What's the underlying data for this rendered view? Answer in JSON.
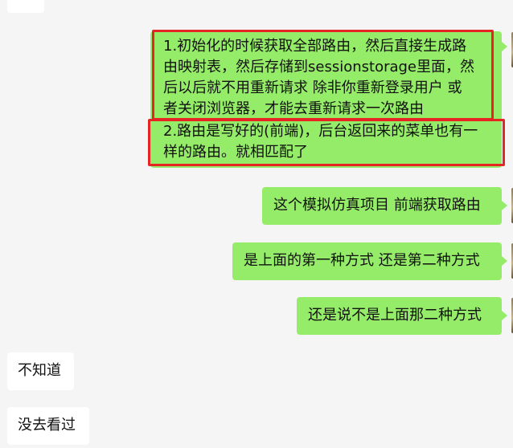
{
  "chat": {
    "messages": [
      {
        "side": "out",
        "lines": [
          "1.初始化的时候获取全部路由，然后直接生成路",
          "由映射表，然后存储到sessionstorage里面，然",
          "后以后就不用重新请求  除非你重新登录用户 或",
          "者关闭浏览器，才能去重新请求一次路由",
          "2.路由是写好的(前端)，后台返回来的菜单也有一",
          "样的路由。就相匹配了"
        ]
      },
      {
        "side": "out",
        "text": "这个模拟仿真项目 前端获取路由"
      },
      {
        "side": "out",
        "text": "是上面的第一种方式 还是第二种方式"
      },
      {
        "side": "out",
        "text": "还是说不是上面那二种方式"
      },
      {
        "side": "in",
        "text": "不知道"
      },
      {
        "side": "in",
        "text": "没去看过"
      }
    ]
  },
  "annotation": {
    "highlight_color": "#e62424"
  },
  "colors": {
    "outgoing_bubble": "#95ec69",
    "incoming_bubble": "#ffffff",
    "background": "#f5f5f5"
  }
}
